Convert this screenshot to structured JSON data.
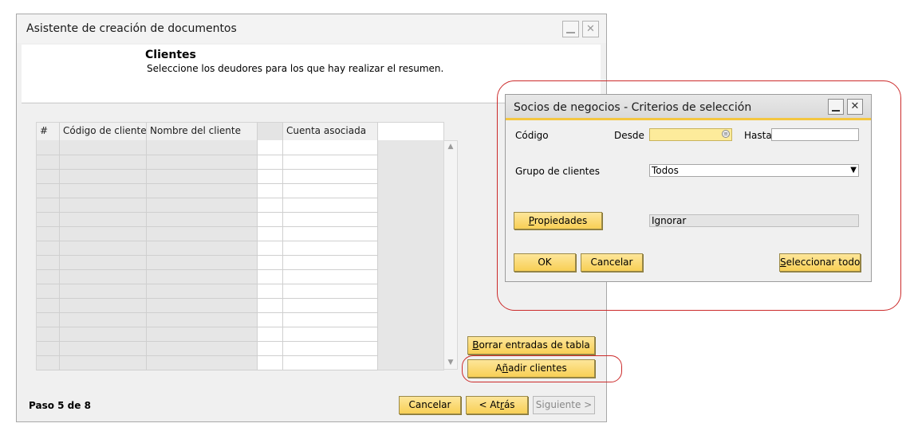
{
  "wizard": {
    "title": "Asistente de creación de documentos",
    "header_title": "Clientes",
    "header_subtitle": "Seleccione los deudores para los que hay realizar el resumen.",
    "columns": [
      "#",
      "Código de cliente",
      "Nombre del cliente",
      "",
      "Cuenta asociada"
    ],
    "row_count": 16,
    "buttons": {
      "clear_table_pre": "",
      "clear_table_u": "B",
      "clear_table_post": "orrar entradas de tabla",
      "add_clients_pre": "A",
      "add_clients_u": "ñ",
      "add_clients_post": "adir clientes",
      "cancel": "Cancelar",
      "back_pre": "< At",
      "back_u": "r",
      "back_post": "ás",
      "next": "Siguiente >"
    },
    "step": "Paso 5 de 8"
  },
  "dialog": {
    "title": "Socios de negocios - Criterios de selección",
    "code_label": "Código",
    "from_label": "Desde",
    "to_label": "Hasta",
    "from_value": "",
    "to_value": "",
    "group_label": "Grupo de clientes",
    "group_value": "Todos",
    "properties_u": "P",
    "properties_post": "ropiedades",
    "properties_value": "Ignorar",
    "ok": "OK",
    "cancel": "Cancelar",
    "select_all_u": "S",
    "select_all_post": "eleccionar todo"
  },
  "colors": {
    "accent_yellow": "#f8cf55",
    "highlight_red": "#cc2a2a"
  }
}
